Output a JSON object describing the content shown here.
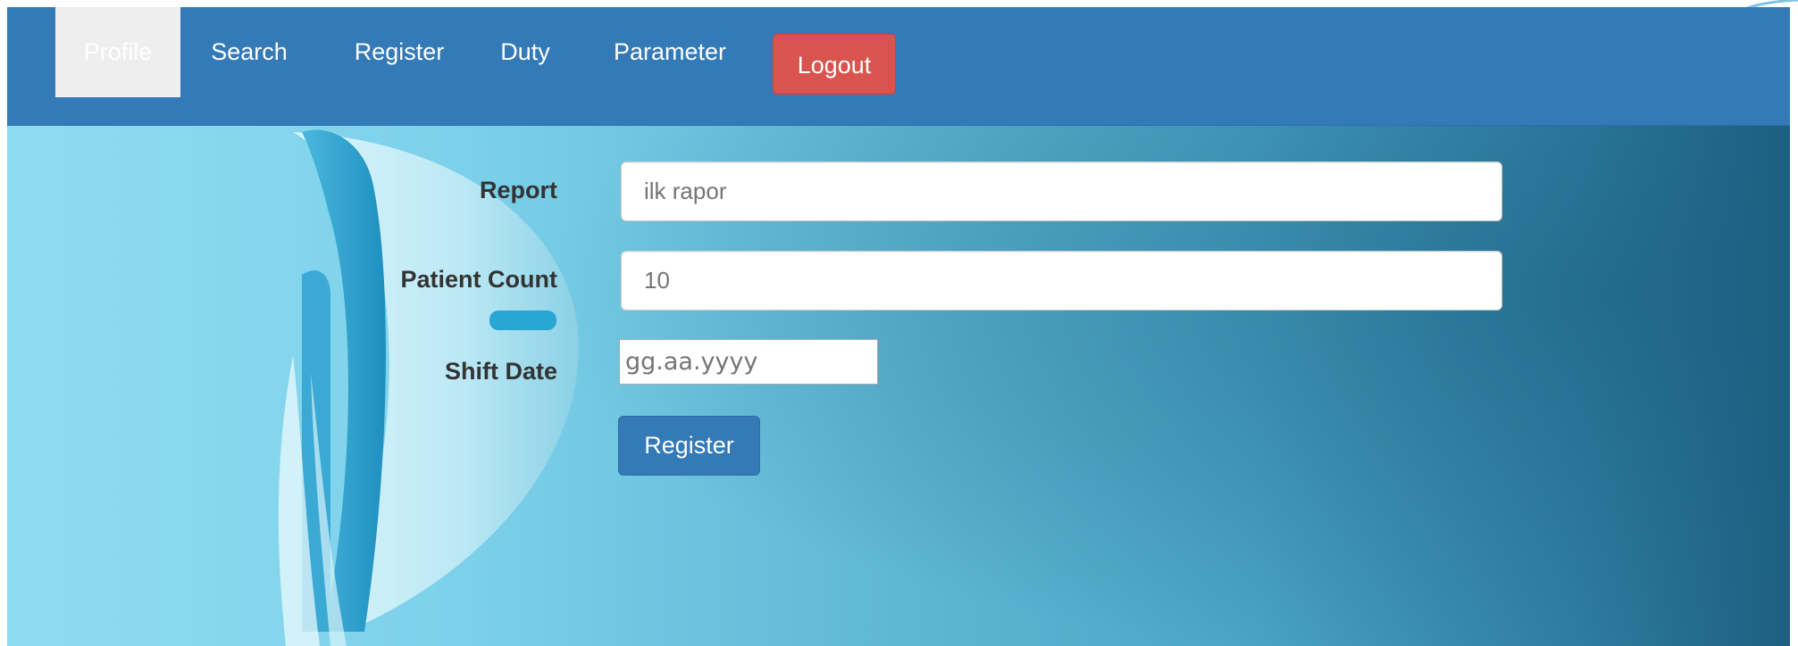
{
  "navbar": {
    "items": [
      {
        "label": "Profile",
        "active": true
      },
      {
        "label": "Search",
        "active": false
      },
      {
        "label": "Register",
        "active": false
      },
      {
        "label": "Duty",
        "active": false
      },
      {
        "label": "Parameter",
        "active": false
      }
    ],
    "logout_label": "Logout",
    "color": "#337ab7",
    "active_bg": "#eeeeee",
    "logout_color": "#d9534f"
  },
  "form": {
    "report": {
      "label": "Report",
      "placeholder": "ilk rapor"
    },
    "patient_count": {
      "label": "Patient Count",
      "placeholder": "10"
    },
    "shift_date": {
      "label": "Shift Date",
      "placeholder": "gg.aa.yyyy"
    },
    "submit_label": "Register"
  }
}
